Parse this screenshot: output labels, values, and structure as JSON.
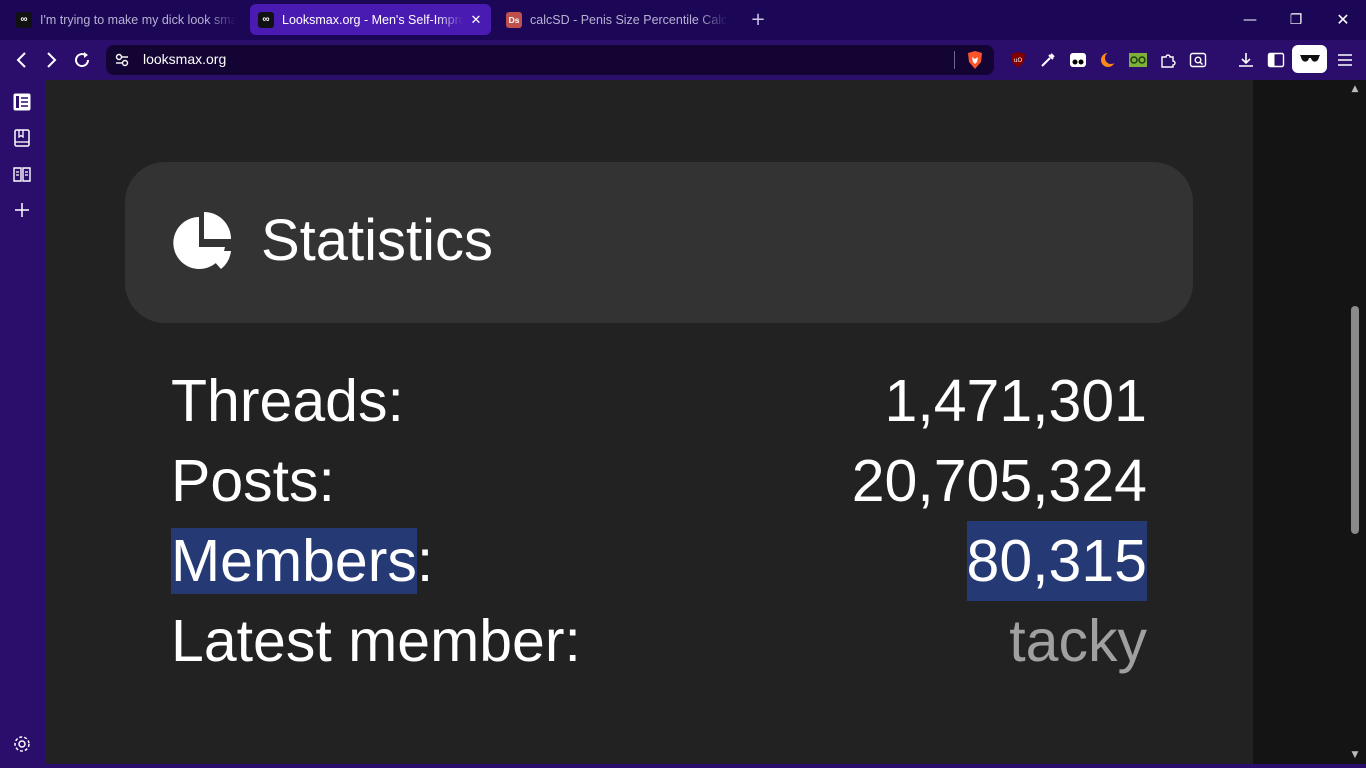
{
  "tabs": [
    {
      "title": "I'm trying to make my dick look smaller",
      "favicon": "infinity-icon",
      "active": false
    },
    {
      "title": "Looksmax.org - Men's Self-Improvement",
      "favicon": "infinity-icon",
      "active": true
    },
    {
      "title": "calcSD - Penis Size Percentile Calculator",
      "favicon_text": "Ds",
      "active": false
    }
  ],
  "address_bar": {
    "url": "looksmax.org"
  },
  "toolbar_icons": [
    "back-icon",
    "forward-icon",
    "reload-icon",
    "site-info-icon",
    "brave-shields-icon",
    "ublock-icon",
    "eyedropper-icon",
    "tampermonkey-icon",
    "dark-reader-icon",
    "glasses-extension-icon",
    "extensions-icon",
    "search-tab-icon",
    "download-icon",
    "sidebar-toggle-icon",
    "reader-mode-icon",
    "menu-icon"
  ],
  "sidebar_icons": [
    "reading-list-icon",
    "bookmarks-icon",
    "reader-icon",
    "add-icon",
    "settings-icon"
  ],
  "statistics": {
    "title": "Statistics",
    "rows": [
      {
        "label": "Threads:",
        "value": "1,471,301"
      },
      {
        "label": "Posts:",
        "value": "20,705,324"
      },
      {
        "label_selected": "Members",
        "label_rest": ":",
        "value": "80,315"
      },
      {
        "label": "Latest member:",
        "value": "tacky"
      }
    ]
  },
  "colors": {
    "tabstrip": "#1c0757",
    "active_tab": "#4a1bb3",
    "toolbar": "#2b0d6b",
    "page_bg": "#222222",
    "card_bg": "#333333",
    "selection": "#253a74",
    "link_muted": "#a0a0a0"
  }
}
